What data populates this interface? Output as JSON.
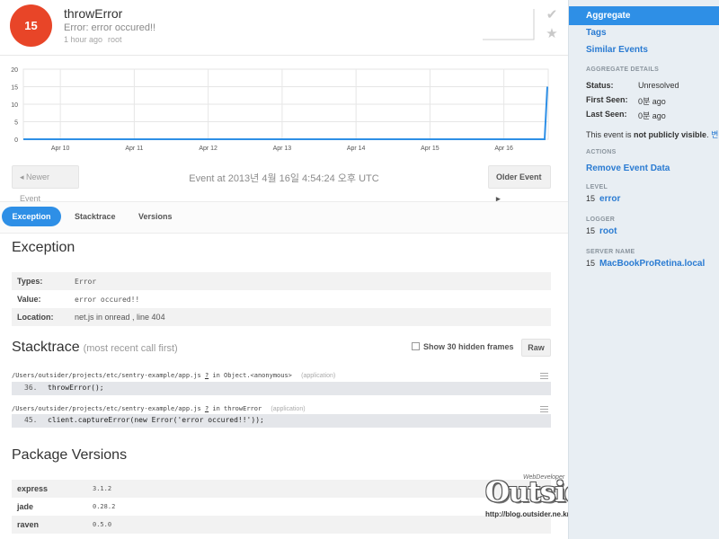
{
  "event": {
    "count": "15",
    "title": "throwError",
    "message": "Error: error occured!!",
    "time_ago": "1 hour ago",
    "logger": "root"
  },
  "header_icons": [
    "check-icon",
    "star-icon"
  ],
  "chart_data": {
    "type": "line",
    "x_ticks": [
      "Apr 10",
      "Apr 11",
      "Apr 12",
      "Apr 13",
      "Apr 14",
      "Apr 15",
      "Apr 16"
    ],
    "y_ticks": [
      "0",
      "5",
      "10",
      "15",
      "20"
    ],
    "ylim": [
      0,
      20
    ],
    "series": [
      {
        "values": [
          0,
          0,
          0,
          0,
          0,
          0,
          0,
          15
        ]
      }
    ],
    "grid": true,
    "line_color": "#2e8fe6"
  },
  "nav": {
    "newer": "Newer Event",
    "older": "Older Event",
    "event_time": "Event at 2013년 4월 16일 4:54:24 오후 UTC"
  },
  "tabs": [
    "Exception",
    "Stacktrace",
    "Versions"
  ],
  "exception": {
    "title": "Exception",
    "rows": [
      {
        "key": "Types:",
        "value": "Error"
      },
      {
        "key": "Value:",
        "value": "error occured!!"
      },
      {
        "key": "Location:",
        "value": "net.js in onread , line 404"
      }
    ]
  },
  "stacktrace": {
    "title": "Stacktrace",
    "subtitle": "(most recent call first)",
    "hidden_frames": "Show 30 hidden frames",
    "raw": "Raw",
    "frames": [
      {
        "path": "/Users/outsider/projects/etc/sentry-example/app.js",
        "q": "?",
        "in_text": "in",
        "func": "Object.<anonymous>",
        "tag": "(application)",
        "lineno": "36.",
        "code": "throwError();"
      },
      {
        "path": "/Users/outsider/projects/etc/sentry-example/app.js",
        "q": "?",
        "in_text": "in",
        "func": "throwError",
        "tag": "(application)",
        "lineno": "45.",
        "code": "client.captureError(new Error('error occured!!'));"
      }
    ]
  },
  "packages": {
    "title": "Package Versions",
    "rows": [
      {
        "name": "express",
        "version": "3.1.2"
      },
      {
        "name": "jade",
        "version": "0.28.2"
      },
      {
        "name": "raven",
        "version": "0.5.0"
      }
    ]
  },
  "watermark": {
    "main": "Outsider",
    "top": "WebDeveloper",
    "url": "http://blog.outsider.ne.kr"
  },
  "sidebar": {
    "active": "Aggregate",
    "links": [
      "Tags",
      "Similar Events"
    ],
    "aggregate_heading": "AGGREGATE DETAILS",
    "status_label": "Status:",
    "status_value": "Unresolved",
    "first_seen_label": "First Seen:",
    "first_seen_value": "0분 ago",
    "last_seen_label": "Last Seen:",
    "last_seen_value": "0분 ago",
    "visibility_prefix": "This event is",
    "visibility_bold": "not publicly visible",
    "visibility_suffix": ".",
    "visibility_link": "변경",
    "actions_heading": "ACTIONS",
    "remove_action": "Remove Event Data",
    "level_heading": "LEVEL",
    "level_count": "15",
    "level_value": "error",
    "logger_heading": "LOGGER",
    "logger_count": "15",
    "logger_value": "root",
    "server_heading": "SERVER NAME",
    "server_count": "15",
    "server_value": "MacBookProRetina.local"
  }
}
